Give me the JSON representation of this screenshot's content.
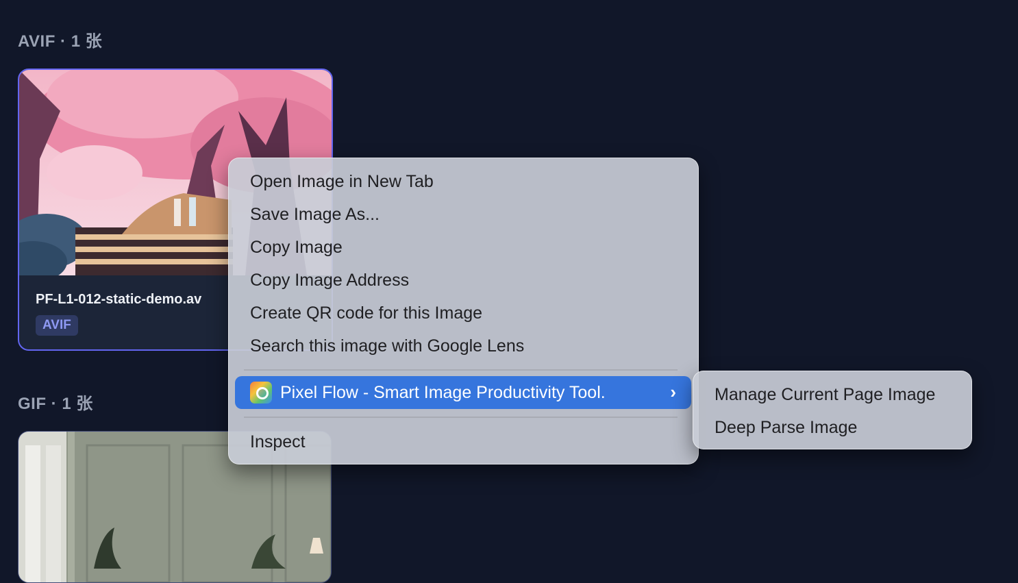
{
  "sections": [
    {
      "title": "AVIF · 1 张",
      "card": {
        "filename": "PF-L1-012-static-demo.av",
        "badge": "AVIF"
      }
    },
    {
      "title": "GIF · 1 张"
    }
  ],
  "context_menu": {
    "items": [
      "Open Image in New Tab",
      "Save Image As...",
      "Copy Image",
      "Copy Image Address",
      "Create QR code for this Image",
      "Search this image with Google Lens"
    ],
    "extension_item": {
      "label": "Pixel Flow - Smart Image Productivity Tool.",
      "icon": "pixel-flow-app-icon",
      "chevron": "›"
    },
    "inspect": "Inspect"
  },
  "submenu": {
    "items": [
      "Manage Current Page Image",
      "Deep Parse Image"
    ]
  },
  "colors": {
    "background": "#111729",
    "accent": "#6366f1",
    "menu_highlight": "#3675dd",
    "badge_text": "#8e99f3"
  }
}
